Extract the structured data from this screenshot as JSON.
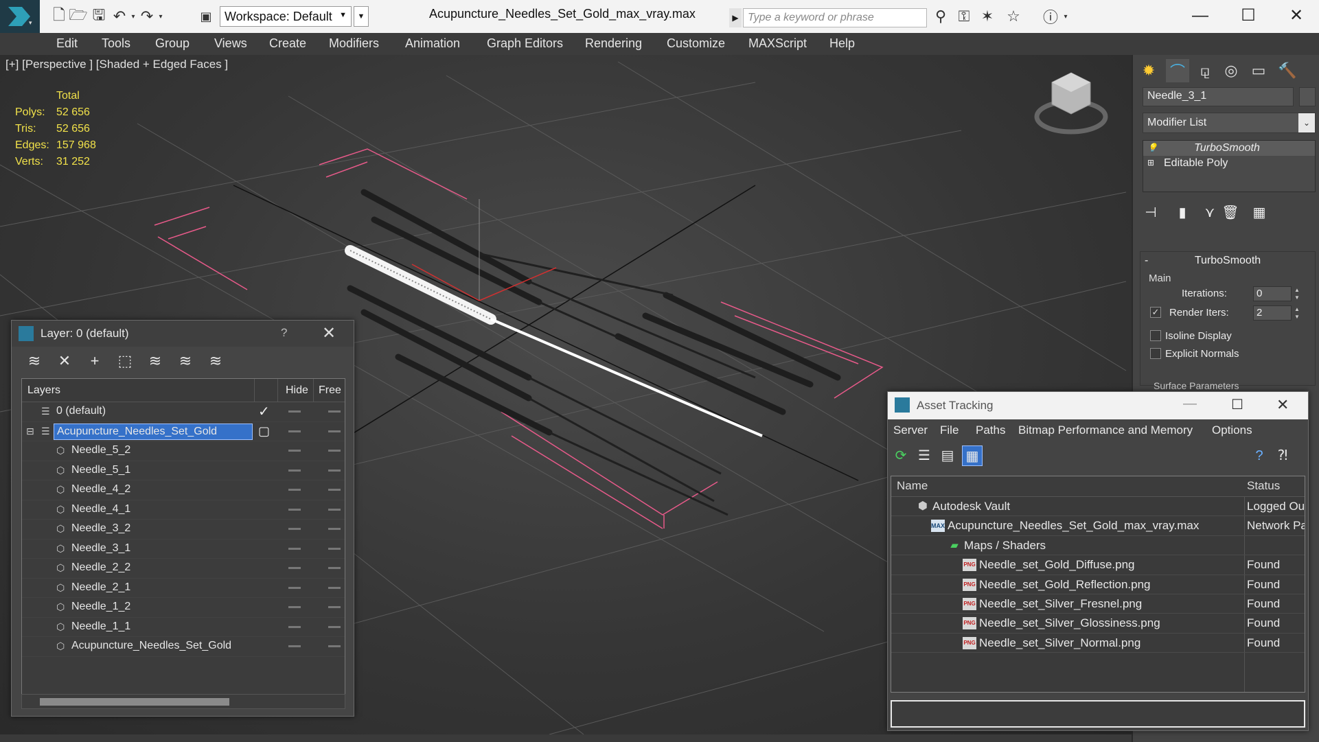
{
  "titlebar": {
    "workspace_label": "Workspace: Default",
    "file_title": "Acupuncture_Needles_Set_Gold_max_vray.max",
    "search_placeholder": "Type a keyword or phrase"
  },
  "menubar": {
    "items": [
      "Edit",
      "Tools",
      "Group",
      "Views",
      "Create",
      "Modifiers",
      "Animation",
      "Graph Editors",
      "Rendering",
      "Customize",
      "MAXScript",
      "Help"
    ]
  },
  "viewport": {
    "label": "[+] [Perspective ] [Shaded + Edged Faces ]",
    "stats_header": "Total",
    "stats": [
      {
        "label": "Polys:",
        "value": "52 656"
      },
      {
        "label": "Tris:",
        "value": "52 656"
      },
      {
        "label": "Edges:",
        "value": "157 968"
      },
      {
        "label": "Verts:",
        "value": "31 252"
      }
    ],
    "stats_color": "#f2e24a"
  },
  "command_panel": {
    "object_name": "Needle_3_1",
    "modifier_list_label": "Modifier List",
    "stack": [
      {
        "label": "TurboSmooth",
        "selected": true
      },
      {
        "label": "Editable Poly",
        "selected": false
      }
    ],
    "rollout_title": "TurboSmooth",
    "group_main": "Main",
    "iterations_label": "Iterations:",
    "iterations_value": "0",
    "render_iters_label": "Render Iters:",
    "render_iters_value": "2",
    "isoline_label": "Isoline Display",
    "explicit_normals_label": "Explicit Normals",
    "surface_params_label": "Surface Parameters"
  },
  "layer_dialog": {
    "title": "Layer: 0 (default)",
    "help": "?",
    "columns": {
      "layers": "Layers",
      "hide": "Hide",
      "freeze": "Free"
    },
    "rows": [
      {
        "name": "0 (default)",
        "level": 0,
        "type": "layer"
      },
      {
        "name": "Acupuncture_Needles_Set_Gold",
        "level": 0,
        "type": "layer",
        "selected": true
      },
      {
        "name": "Needle_5_2",
        "level": 1,
        "type": "object"
      },
      {
        "name": "Needle_5_1",
        "level": 1,
        "type": "object"
      },
      {
        "name": "Needle_4_2",
        "level": 1,
        "type": "object"
      },
      {
        "name": "Needle_4_1",
        "level": 1,
        "type": "object"
      },
      {
        "name": "Needle_3_2",
        "level": 1,
        "type": "object"
      },
      {
        "name": "Needle_3_1",
        "level": 1,
        "type": "object"
      },
      {
        "name": "Needle_2_2",
        "level": 1,
        "type": "object"
      },
      {
        "name": "Needle_2_1",
        "level": 1,
        "type": "object"
      },
      {
        "name": "Needle_1_2",
        "level": 1,
        "type": "object"
      },
      {
        "name": "Needle_1_1",
        "level": 1,
        "type": "object"
      },
      {
        "name": "Acupuncture_Needles_Set_Gold",
        "level": 1,
        "type": "object"
      }
    ]
  },
  "asset_dialog": {
    "title": "Asset Tracking",
    "menu": [
      "Server",
      "File",
      "Paths",
      "Bitmap Performance and Memory",
      "Options"
    ],
    "columns": {
      "name": "Name",
      "status": "Status"
    },
    "rows": [
      {
        "name": "Autodesk Vault",
        "status": "Logged Ou",
        "level": 0,
        "icon": "vault-icon"
      },
      {
        "name": "Acupuncture_Needles_Set_Gold_max_vray.max",
        "status": "Network Pa",
        "level": 1,
        "icon": "max-file-icon"
      },
      {
        "name": "Maps / Shaders",
        "status": "",
        "level": 2,
        "icon": "maps-icon"
      },
      {
        "name": "Needle_set_Gold_Diffuse.png",
        "status": "Found",
        "level": 3,
        "icon": "png-icon"
      },
      {
        "name": "Needle_set_Gold_Reflection.png",
        "status": "Found",
        "level": 3,
        "icon": "png-icon"
      },
      {
        "name": "Needle_set_Silver_Fresnel.png",
        "status": "Found",
        "level": 3,
        "icon": "png-icon"
      },
      {
        "name": "Needle_set_Silver_Glossiness.png",
        "status": "Found",
        "level": 3,
        "icon": "png-icon"
      },
      {
        "name": "Needle_set_Silver_Normal.png",
        "status": "Found",
        "level": 3,
        "icon": "png-icon"
      }
    ]
  }
}
